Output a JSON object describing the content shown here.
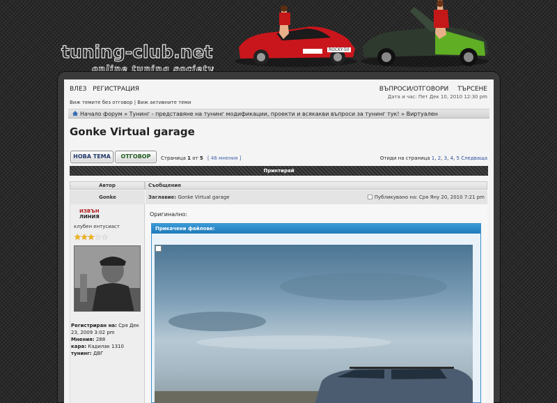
{
  "header": {
    "logo_main": "tuning-club.net",
    "logo_sub": "online tuning society",
    "plate_text": "ROCKY-50"
  },
  "nav": {
    "login": "ВЛЕЗ",
    "register": "РЕГИСТРАЦИЯ",
    "faq": "ВЪПРОСИ/ОТГОВОРИ",
    "search": "ТЪРСЕНЕ",
    "datetime": "Дата и час: Пет Дек 10, 2010 12:30 pm",
    "unanswered": "Виж темите без отговор",
    "separator": "|",
    "active": "Виж активните теми"
  },
  "breadcrumb": {
    "text": "Начало форум » Тунинг - представяне на тунинг модификации, проекти и всякакви въпроси за тунинг тук! » Виртуален"
  },
  "topic": {
    "title": "Gonke Virtual garage"
  },
  "buttons": {
    "new_topic": "НОВА ТЕМА",
    "reply": "ОТГОВОР"
  },
  "pagination": {
    "page_prefix": "Страница",
    "current": "1",
    "of_word": "от",
    "total": "5",
    "count_text": "[ 46 мнения ]",
    "goto_label": "Отиди на страница",
    "pages": [
      "1",
      "2",
      "3",
      "4",
      "5"
    ],
    "next": "Следваща"
  },
  "print_bar": "Принтирай",
  "columns": {
    "author": "Автор",
    "message": "Съобщение"
  },
  "post": {
    "author": "Gonke",
    "subject_label": "Заглавие:",
    "subject": "Gonke Virtual garage",
    "posted": "Публикувано на: Сря Яну 20, 2010 7:21 pm",
    "status_line1": "ИЗВЪН",
    "status_line2": "ЛИНИЯ",
    "rank": "клубен ентусиаст",
    "stars_on": "★★★",
    "stars_off": "☆☆",
    "registered_label": "Регистриран на:",
    "registered": "Сря Дек 23, 2009 3:02 pm",
    "posts_label": "Мнения:",
    "posts": "288",
    "car_label": "кара:",
    "car": "Кадилак 1310",
    "tuning_label": "тунинг:",
    "tuning": "ДВГ",
    "original_label": "Оригинално:",
    "attachments_label": "Прикачени файлове:"
  },
  "colors": {
    "accent_blue": "#1f7ab8",
    "offline_red": "#b01c1c",
    "star_gold": "#f2b318"
  }
}
